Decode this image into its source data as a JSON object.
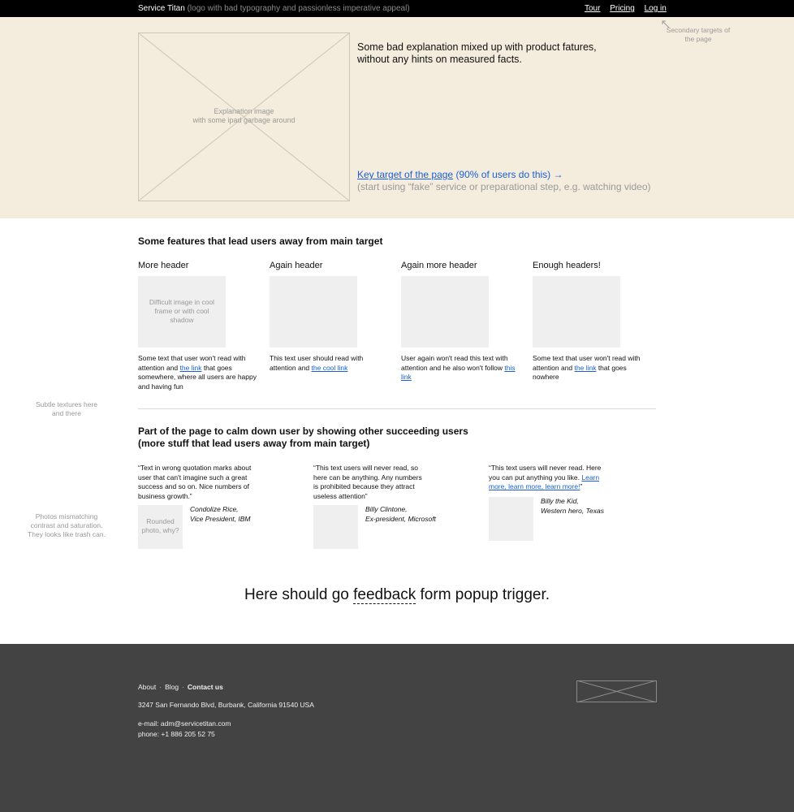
{
  "topbar": {
    "brand": "Service Titan",
    "tagline": "(logo with bad typography and passionless imperative appeal)",
    "nav": [
      "Tour",
      "Pricing",
      "Log in"
    ]
  },
  "hero": {
    "image_caption_1": "Explanation image",
    "image_caption_2": "with some ipad garbage around",
    "text": "Some bad explanation mixed up with product fatures, without any hints on measured facts.",
    "cta_link": "Key target of the page",
    "cta_suffix": "(90% of users do this) →",
    "cta_sub": "(start using “fake” service or preparational step, e.g. watching video)",
    "secondary_note": "Secondary targets of the page"
  },
  "features": {
    "title": "Some features that lead users away from main target",
    "items": [
      {
        "header": "More header",
        "image_caption": "Difficult image in cool frame or with cool shadow",
        "text_before": "Some text that user won't read with attention and ",
        "link": "the link",
        "text_after": " that goes somewhere, where all users are happy and having fun"
      },
      {
        "header": "Again header",
        "image_caption": "",
        "text_before": "This text user should read with attention and ",
        "link": "the cool link",
        "text_after": ""
      },
      {
        "header": "Again more header",
        "image_caption": "",
        "text_before": "User again won't read this text with attention and he also won't follow ",
        "link": "this link",
        "text_after": ""
      },
      {
        "header": "Enough headers!",
        "image_caption": "",
        "text_before": "Some text that user won't read with attention and ",
        "link": "the link",
        "text_after": " that goes nowhere"
      }
    ]
  },
  "notes": {
    "textures": "Subtle textures here and there",
    "photos": "Photos mismatching contrast and saturation. They looks like trash can."
  },
  "testimonials": {
    "title_line1": "Part of the page to calm down user by showing other succeeding users",
    "title_line2": "(more stuff that lead users away from main target)",
    "items": [
      {
        "quote": "“Text in wrong quotation marks about user that can't imagine such a great success and so on. Nice numbers of business growth.”",
        "photo_caption": "Rounded photo, why?",
        "name": "Condolize Rice,",
        "role": "Vice President, IBM"
      },
      {
        "quote": "“This text users will never read, so here can be anything. Any numbers is prohibited because they attract useless attention”",
        "photo_caption": "",
        "name": "Billy Clintone,",
        "role": "Ex-president, Microsoft"
      },
      {
        "quote_before": "“This text users will never read. Here you can put anything you like. ",
        "link": "Learn more, learn more, learn more!",
        "quote_after": "”",
        "photo_caption": "",
        "name": "Billy the Kid,",
        "role": "Western hero, Texas"
      }
    ]
  },
  "feedback": {
    "before": "Here should go ",
    "dashed": "feedback",
    "after": " form popup trigger."
  },
  "footer": {
    "links": [
      "About",
      "Blog",
      "Contact us"
    ],
    "address": "3247 San Fernando Blvd, Burbank, California 91540 USA",
    "email_label": "e-mail: ",
    "email": "adm@servicetitan.com",
    "phone": "phone: +1 886 205 52 75"
  }
}
